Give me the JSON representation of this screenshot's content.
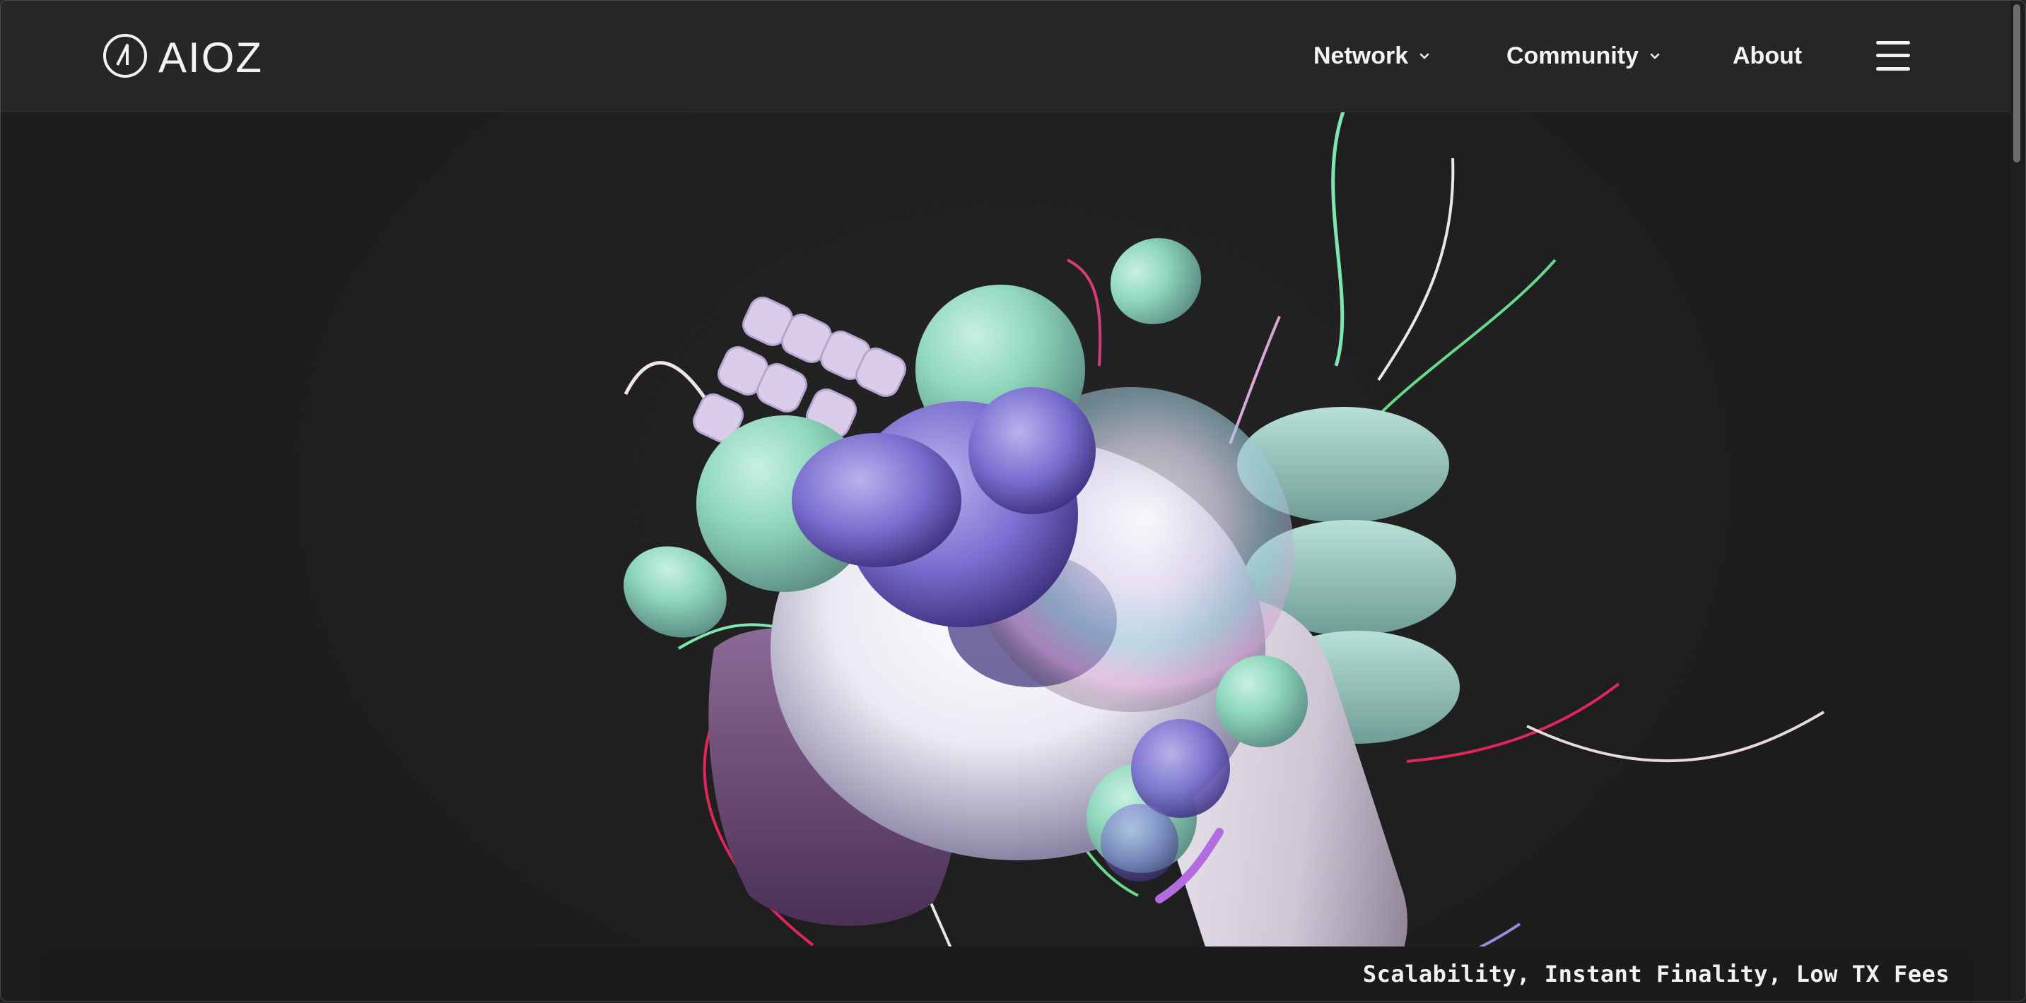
{
  "brand": {
    "name": "AIOZ",
    "logo_icon": "aioz-circle-logo-icon"
  },
  "nav": {
    "items": [
      {
        "label": "Network",
        "has_dropdown": true
      },
      {
        "label": "Community",
        "has_dropdown": true
      },
      {
        "label": "About",
        "has_dropdown": false
      }
    ],
    "menu_icon": "hamburger-menu-icon"
  },
  "ticker": {
    "text": "Scalability, Instant Finality, Low TX Fees"
  },
  "colors": {
    "background": "#222223",
    "header": "#262627",
    "text": "#f3f3f3",
    "accent_mint": "#8fd8bd",
    "accent_lavender": "#8b7fd6",
    "accent_pink": "#e0265a"
  }
}
